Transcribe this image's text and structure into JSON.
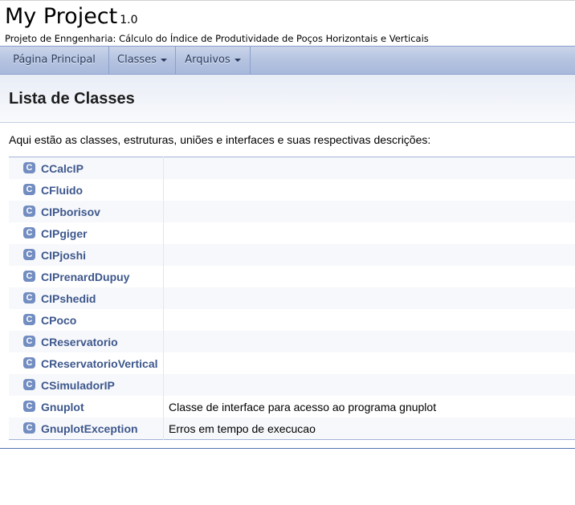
{
  "project": {
    "name": "My Project",
    "number": "1.0",
    "brief": "Projeto de Enngenharia: Cálculo do Índice de Produtividade de Poços Horizontais e Verticais"
  },
  "nav": {
    "items": [
      {
        "label": "Página Principal",
        "has_dropdown": false
      },
      {
        "label": "Classes",
        "has_dropdown": true
      },
      {
        "label": "Arquivos",
        "has_dropdown": true
      }
    ]
  },
  "page": {
    "title": "Lista de Classes",
    "intro": "Aqui estão as classes, estruturas, uniões e interfaces e suas respectivas descrições:"
  },
  "class_icon_letter": "C",
  "classes": [
    {
      "name": "CCalcIP",
      "desc": ""
    },
    {
      "name": "CFluido",
      "desc": ""
    },
    {
      "name": "CIPborisov",
      "desc": ""
    },
    {
      "name": "CIPgiger",
      "desc": ""
    },
    {
      "name": "CIPjoshi",
      "desc": ""
    },
    {
      "name": "CIPrenardDupuy",
      "desc": ""
    },
    {
      "name": "CIPshedid",
      "desc": ""
    },
    {
      "name": "CPoco",
      "desc": ""
    },
    {
      "name": "CReservatorio",
      "desc": ""
    },
    {
      "name": "CReservatorioVertical",
      "desc": ""
    },
    {
      "name": "CSimuladorIP",
      "desc": ""
    },
    {
      "name": "Gnuplot",
      "desc": "Classe de interface para acesso ao programa gnuplot"
    },
    {
      "name": "GnuplotException",
      "desc": "Erros em tempo de execucao"
    }
  ],
  "colors": {
    "link": "#3d578c",
    "icon_bg": "#728dc1",
    "nav_text": "#283a5d",
    "row_alt": "#f7f8fb"
  }
}
